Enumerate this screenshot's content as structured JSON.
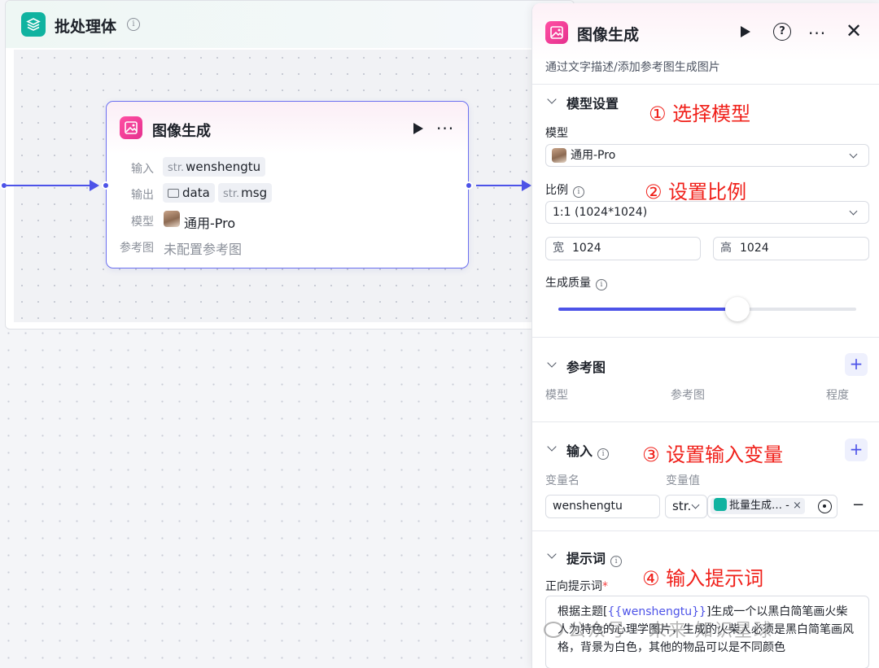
{
  "batch": {
    "title": "批处理体"
  },
  "node": {
    "title": "图像生成",
    "input_label": "输入",
    "input_tag_type": "str.",
    "input_tag_name": "wenshengtu",
    "output_label": "输出",
    "output_tag1_name": "data",
    "output_tag2_type": "str.",
    "output_tag2_name": "msg",
    "model_label": "模型",
    "model_value": "通用-Pro",
    "ref_label": "参考图",
    "ref_value": "未配置参考图"
  },
  "panel": {
    "title": "图像生成",
    "description": "通过文字描述/添加参考图生成图片",
    "model_settings": {
      "title": "模型设置",
      "model_label": "模型",
      "model_value": "通用-Pro",
      "ratio_label": "比例",
      "ratio_value": "1:1 (1024*1024)",
      "width_prefix": "宽",
      "width_value": "1024",
      "height_prefix": "高",
      "height_value": "1024",
      "quality_label": "生成质量",
      "quality_level": 0.6
    },
    "reference": {
      "title": "参考图",
      "col_model": "模型",
      "col_image": "参考图",
      "col_degree": "程度"
    },
    "inputs": {
      "title": "输入",
      "col_name": "变量名",
      "col_value": "变量值",
      "var_name": "wenshengtu",
      "var_type": "str.",
      "var_ref": "批量生成…",
      "var_ref_suffix": "-"
    },
    "prompt": {
      "title": "提示词",
      "positive_label": "正向提示词",
      "required_mark": "*",
      "text_before": "根据主题[",
      "text_var": "{{wenshengtu}}",
      "text_after": "]生成一个以黑白简笔画火柴人为特色的心理学图片，生成的火柴人必须是黑白简笔画风格，背景为白色，其他的物品可以是不同颜色"
    }
  },
  "annotations": {
    "a1": "① 选择模型",
    "a2": "② 设置比例",
    "a3": "③ 设置输入变量",
    "a4": "④ 输入提示词"
  },
  "watermark": "公众号 · 未来·知识星球",
  "colors": {
    "accent": "#4d53e8",
    "annotation": "#f0201a",
    "batch_logo": "#10b3a0",
    "image_icon": "#e5308e"
  },
  "icons": [
    "batch-layers-icon",
    "image-gen-icon",
    "play-icon",
    "more-icon",
    "help-icon",
    "close-icon",
    "chevron-down-icon",
    "info-icon",
    "plus-icon",
    "target-icon",
    "minus-icon"
  ]
}
